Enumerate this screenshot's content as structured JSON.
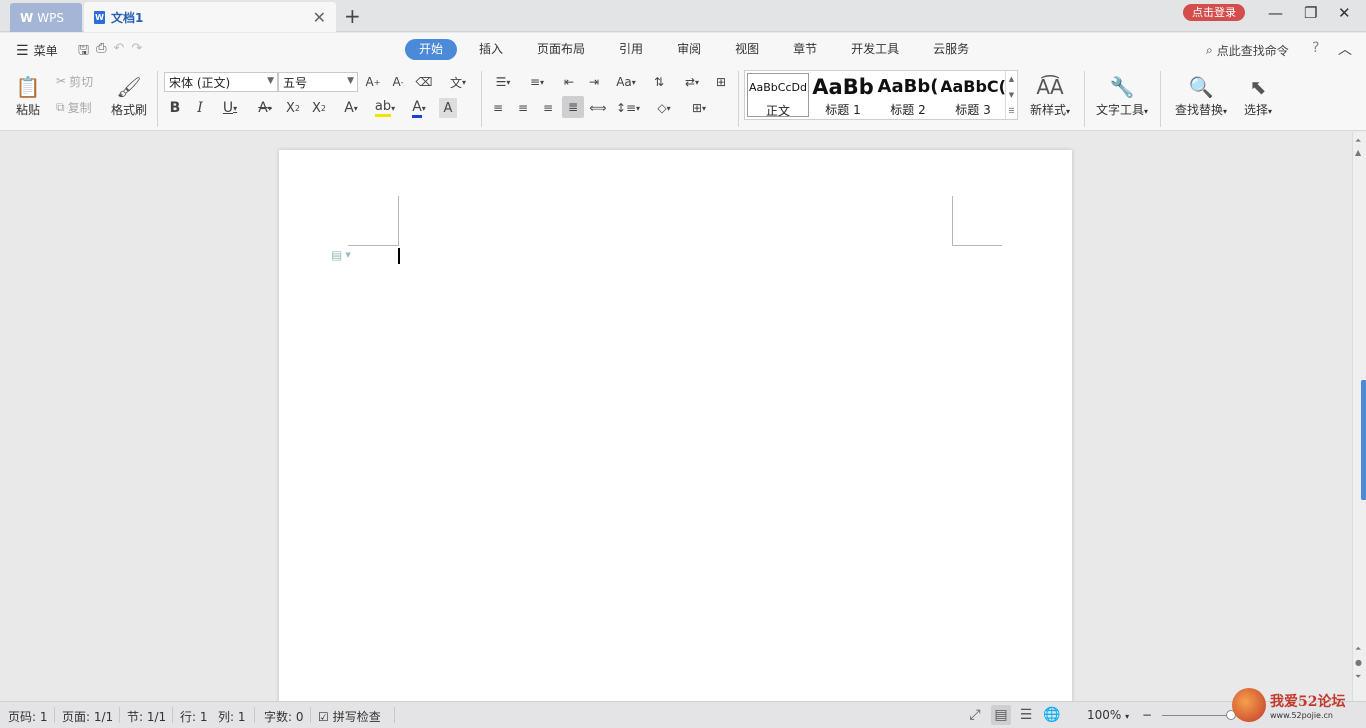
{
  "titlebar": {
    "wps_tab": "WPS",
    "doc_tab": "文档1",
    "login_button": "点击登录"
  },
  "menubar": {
    "menu_label": "菜单",
    "tabs": [
      {
        "label": "开始",
        "active": true
      },
      {
        "label": "插入"
      },
      {
        "label": "页面布局"
      },
      {
        "label": "引用"
      },
      {
        "label": "审阅"
      },
      {
        "label": "视图"
      },
      {
        "label": "章节"
      },
      {
        "label": "开发工具"
      },
      {
        "label": "云服务"
      }
    ],
    "search_command": "点此查找命令"
  },
  "ribbon": {
    "paste": "粘贴",
    "cut": "剪切",
    "copy": "复制",
    "format_painter": "格式刷",
    "font_name": "宋体 (正文)",
    "font_size": "五号",
    "styles": [
      {
        "sample": "AaBbCcDd",
        "name": "正文"
      },
      {
        "sample": "AaBb",
        "name": "标题 1"
      },
      {
        "sample": "AaBb(",
        "name": "标题 2"
      },
      {
        "sample": "AaBbC(",
        "name": "标题 3"
      }
    ],
    "new_style": "新样式",
    "text_tools": "文字工具",
    "find_replace": "查找替换",
    "select": "选择"
  },
  "statusbar": {
    "page_number": "页码: 1",
    "pages": "页面: 1/1",
    "section": "节: 1/1",
    "row": "行: 1",
    "column": "列: 1",
    "word_count": "字数: 0",
    "spell_check": "拼写检查",
    "zoom": "100%"
  },
  "watermark": {
    "line1": "我爱52论坛",
    "line2": "www.52pojie.cn"
  },
  "colors": {
    "accent": "#4a8ad8",
    "login": "#d44d4d",
    "wps_tab": "#a4b5d6"
  }
}
